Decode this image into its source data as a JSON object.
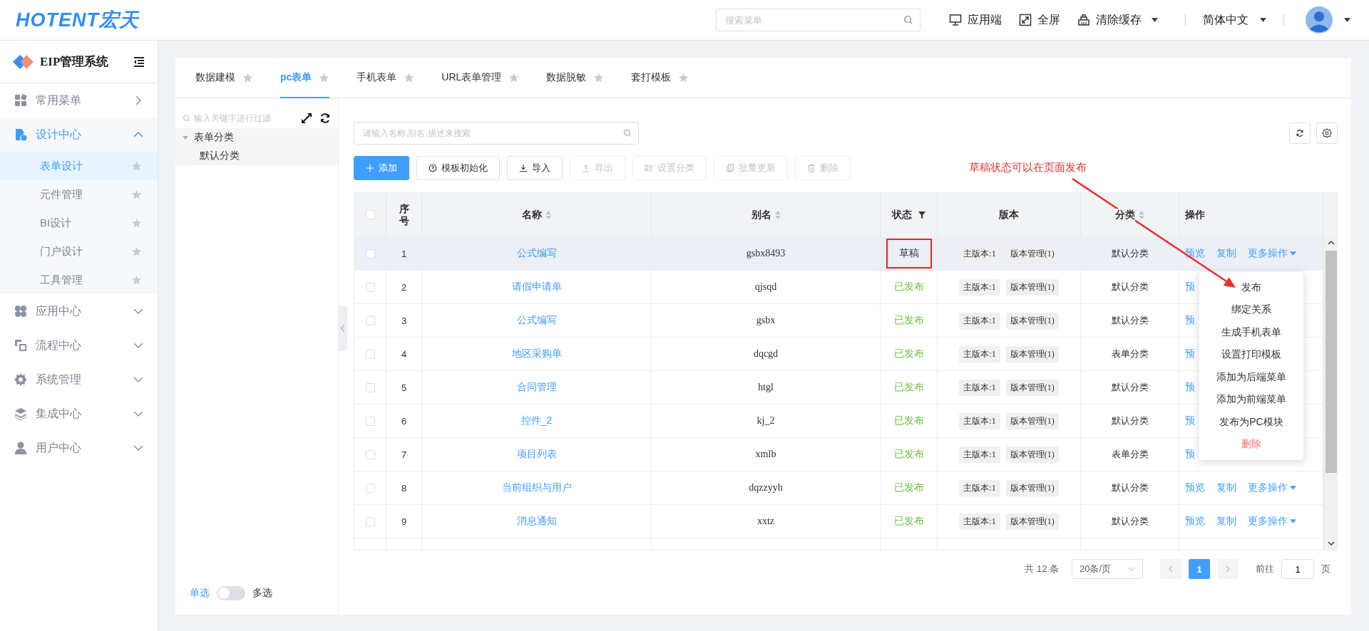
{
  "header": {
    "logo": "HOTENT宏天",
    "search": {
      "placeholder": "搜索菜单"
    },
    "actions": [
      {
        "label": "应用端",
        "kind": "monitor",
        "dropdown": false
      },
      {
        "label": "全屏",
        "kind": "fullscreen",
        "dropdown": false
      },
      {
        "label": "清除缓存",
        "kind": "clear",
        "dropdown": true
      }
    ],
    "language": "简体中文"
  },
  "sidebar": {
    "title": "EIP管理系统",
    "items": [
      {
        "label": "常用菜单",
        "kind": "grid",
        "submenu": false,
        "expanded": false
      },
      {
        "label": "设计中心",
        "kind": "design",
        "submenu": true,
        "expanded": true,
        "children": [
          {
            "label": "表单设计",
            "selected": true
          },
          {
            "label": "元件管理",
            "selected": false
          },
          {
            "label": "BI设计",
            "selected": false
          },
          {
            "label": "门户设计",
            "selected": false
          },
          {
            "label": "工具管理",
            "selected": false
          }
        ]
      },
      {
        "label": "应用中心",
        "kind": "apps",
        "submenu": true,
        "expanded": false
      },
      {
        "label": "流程中心",
        "kind": "flow",
        "submenu": true,
        "expanded": false
      },
      {
        "label": "系统管理",
        "kind": "gear",
        "submenu": true,
        "expanded": false
      },
      {
        "label": "集成中心",
        "kind": "layers",
        "submenu": true,
        "expanded": false
      },
      {
        "label": "用户中心",
        "kind": "user",
        "submenu": true,
        "expanded": false
      }
    ]
  },
  "tabs": [
    {
      "label": "数据建模",
      "selected": false
    },
    {
      "label": "pc表单",
      "selected": true
    },
    {
      "label": "手机表单",
      "selected": false
    },
    {
      "label": "URL表单管理",
      "selected": false
    },
    {
      "label": "数据脱敏",
      "selected": false
    },
    {
      "label": "套打模板",
      "selected": false
    }
  ],
  "tree": {
    "filter": {
      "placeholder": "输入关键字进行过滤"
    },
    "nodes": [
      {
        "label": "表单分类",
        "expanded": true,
        "children": [
          {
            "label": "默认分类"
          }
        ]
      }
    ]
  },
  "select_mode": {
    "left": "单选",
    "right": "多选",
    "on": false
  },
  "search": {
    "placeholder": "请输入名称,别名,描述来搜索"
  },
  "toolbar": [
    {
      "label": "添加",
      "kind": "add",
      "primary": true,
      "disabled": false
    },
    {
      "label": "模板初始化",
      "kind": "template",
      "primary": false,
      "disabled": false
    },
    {
      "label": "导入",
      "kind": "import",
      "primary": false,
      "disabled": false
    },
    {
      "label": "导出",
      "kind": "export",
      "primary": false,
      "disabled": true
    },
    {
      "label": "设置分类",
      "kind": "category",
      "primary": false,
      "disabled": true
    },
    {
      "label": "批量更新",
      "kind": "batch",
      "primary": false,
      "disabled": true
    },
    {
      "label": "删除",
      "kind": "delete",
      "primary": false,
      "disabled": true
    }
  ],
  "annotation": {
    "text": "草稿状态可以在页面发布"
  },
  "table": {
    "select_all": {
      "checked": false
    },
    "columns": [
      {
        "label": "序号",
        "sortable": false,
        "filter": false
      },
      {
        "label": "名称",
        "sortable": true,
        "filter": false
      },
      {
        "label": "别名",
        "sortable": true,
        "filter": false
      },
      {
        "label": "状态",
        "sortable": false,
        "filter": true
      },
      {
        "label": "版本",
        "sortable": false,
        "filter": false
      },
      {
        "label": "分类",
        "sortable": true,
        "filter": false
      },
      {
        "label": "操作",
        "sortable": false,
        "filter": false
      }
    ],
    "rows": [
      {
        "checked": false,
        "hovered": true,
        "highlighted": true,
        "index": "1",
        "name": "公式编写",
        "alias": "gsbx8493",
        "status": "草稿",
        "published": false,
        "versions": [
          "主版本:1",
          "版本管理(1)"
        ],
        "category": "默认分类",
        "actions": [
          {
            "label": "预览",
            "dropdown": false
          },
          {
            "label": "复制",
            "dropdown": false
          },
          {
            "label": "更多操作",
            "dropdown": true
          }
        ]
      },
      {
        "checked": false,
        "hovered": false,
        "highlighted": false,
        "index": "2",
        "name": "请假申请单",
        "alias": "qjsqd",
        "status": "已发布",
        "published": true,
        "versions": [
          "主版本:1",
          "版本管理(1)"
        ],
        "category": "默认分类",
        "actions": [
          {
            "label": "预",
            "dropdown": false
          }
        ]
      },
      {
        "checked": false,
        "hovered": false,
        "highlighted": false,
        "index": "3",
        "name": "公式编写",
        "alias": "gsbx",
        "status": "已发布",
        "published": true,
        "versions": [
          "主版本:1",
          "版本管理(1)"
        ],
        "category": "默认分类",
        "actions": [
          {
            "label": "预",
            "dropdown": false
          }
        ]
      },
      {
        "checked": false,
        "hovered": false,
        "highlighted": false,
        "index": "4",
        "name": "地区采购单",
        "alias": "dqcgd",
        "status": "已发布",
        "published": true,
        "versions": [
          "主版本:1",
          "版本管理(1)"
        ],
        "category": "表单分类",
        "actions": [
          {
            "label": "预",
            "dropdown": false
          }
        ]
      },
      {
        "checked": false,
        "hovered": false,
        "highlighted": false,
        "index": "5",
        "name": "合同管理",
        "alias": "htgl",
        "status": "已发布",
        "published": true,
        "versions": [
          "主版本:1",
          "版本管理(1)"
        ],
        "category": "默认分类",
        "actions": [
          {
            "label": "预",
            "dropdown": false
          }
        ]
      },
      {
        "checked": false,
        "hovered": false,
        "highlighted": false,
        "index": "6",
        "name": "控件_2",
        "alias": "kj_2",
        "status": "已发布",
        "published": true,
        "versions": [
          "主版本:1",
          "版本管理(1)"
        ],
        "category": "默认分类",
        "actions": [
          {
            "label": "预",
            "dropdown": false
          }
        ]
      },
      {
        "checked": false,
        "hovered": false,
        "highlighted": false,
        "index": "7",
        "name": "项目列表",
        "alias": "xmlb",
        "status": "已发布",
        "published": true,
        "versions": [
          "主版本:1",
          "版本管理(1)"
        ],
        "category": "表单分类",
        "actions": [
          {
            "label": "预",
            "dropdown": false
          }
        ]
      },
      {
        "checked": false,
        "hovered": false,
        "highlighted": false,
        "index": "8",
        "name": "当前组织与用户",
        "alias": "dqzzyyh",
        "status": "已发布",
        "published": true,
        "versions": [
          "主版本:1",
          "版本管理(1)"
        ],
        "category": "默认分类",
        "actions": [
          {
            "label": "预览",
            "dropdown": false
          },
          {
            "label": "复制",
            "dropdown": false
          },
          {
            "label": "更多操作",
            "dropdown": true
          }
        ]
      },
      {
        "checked": false,
        "hovered": false,
        "highlighted": false,
        "index": "9",
        "name": "消息通知",
        "alias": "xxtz",
        "status": "已发布",
        "published": true,
        "versions": [
          "主版本:1",
          "版本管理(1)"
        ],
        "category": "默认分类",
        "actions": [
          {
            "label": "预览",
            "dropdown": false
          },
          {
            "label": "复制",
            "dropdown": false
          },
          {
            "label": "更多操作",
            "dropdown": true
          }
        ]
      }
    ]
  },
  "action_menu": {
    "items": [
      {
        "label": "发布",
        "danger": false
      },
      {
        "label": "绑定关系",
        "danger": false
      },
      {
        "label": "生成手机表单",
        "danger": false
      },
      {
        "label": "设置打印模板",
        "danger": false
      },
      {
        "label": "添加为后端菜单",
        "danger": false
      },
      {
        "label": "添加为前端菜单",
        "danger": false
      },
      {
        "label": "发布为PC模块",
        "danger": false
      },
      {
        "label": "删除",
        "danger": true
      }
    ]
  },
  "pagination": {
    "total": "共 12 条",
    "page_size": "20条/页",
    "pages": [
      {
        "label": "1",
        "selected": true
      }
    ],
    "goto_label": "前往",
    "goto_value": "1",
    "page_suffix": "页"
  }
}
